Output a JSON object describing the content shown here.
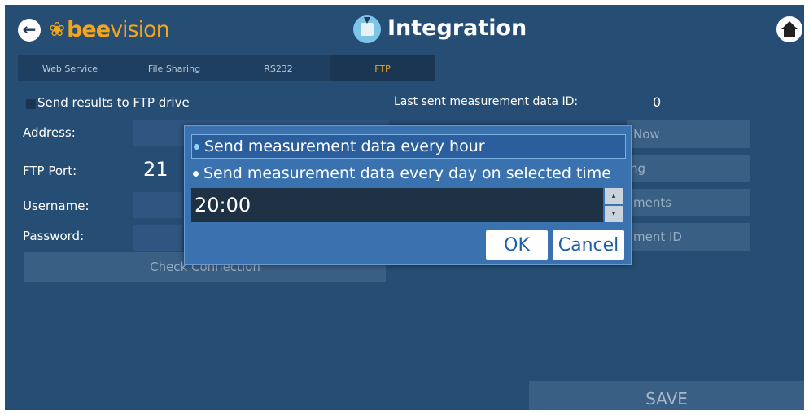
{
  "header": {
    "back_icon": "arrow-left-icon",
    "logo_bee": "bee",
    "logo_vision": "vision",
    "title": "Integration",
    "home_icon": "home-icon"
  },
  "tabs": [
    {
      "label": "Web Service"
    },
    {
      "label": "File Sharing"
    },
    {
      "label": "RS232"
    },
    {
      "label": "FTP",
      "active": true
    }
  ],
  "form": {
    "send_results_label": "Send results to FTP drive",
    "address_label": "Address:",
    "ftp_port_label": "FTP Port:",
    "ftp_port_value": "21",
    "username_label": "Username:",
    "password_label": "Password:",
    "check_connection_label": "Check Connection",
    "last_sent_label": "Last sent measurement data ID:",
    "last_sent_value": "0",
    "right_btn1": "Now",
    "right_btn2": "ng",
    "right_btn3": "ments",
    "right_btn4": "ment ID",
    "save_label": "SAVE"
  },
  "dialog": {
    "option1": "Send measurement data every hour",
    "option2": "Send measurement data every day on selected time",
    "time_value": "20:00",
    "ok_label": "OK",
    "cancel_label": "Cancel"
  },
  "colors": {
    "background": "#264d74",
    "accent": "#f3a51b",
    "dialog": "#3a72b0"
  }
}
